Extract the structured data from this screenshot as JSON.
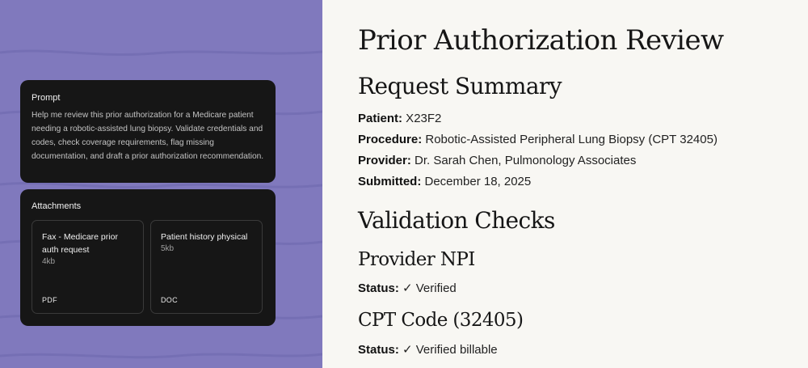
{
  "prompt": {
    "title": "Prompt",
    "text": "Help me review this prior authorization for a Medicare patient needing a robotic-assisted lung biopsy. Validate credentials and codes, check coverage requirements, flag missing documentation, and draft a prior authorization recommendation."
  },
  "attachments": {
    "title": "Attachments",
    "files": [
      {
        "name": "Fax - Medicare prior auth request",
        "size": "4kb",
        "type": "PDF"
      },
      {
        "name": "Patient history physical",
        "size": "5kb",
        "type": "DOC"
      }
    ]
  },
  "document": {
    "title": "Prior Authorization Review",
    "summary": {
      "heading": "Request Summary",
      "patient_label": "Patient:",
      "patient_value": " X23F2",
      "procedure_label": "Procedure:",
      "procedure_value": " Robotic-Assisted Peripheral Lung Biopsy (CPT 32405)",
      "provider_label": "Provider:",
      "provider_value": " Dr. Sarah Chen, Pulmonology Associates",
      "submitted_label": "Submitted:",
      "submitted_value": " December 18, 2025"
    },
    "validation": {
      "heading": "Validation Checks",
      "checks": [
        {
          "heading": "Provider NPI",
          "status_label": "Status:",
          "status_value": " ✓ Verified"
        },
        {
          "heading": "CPT Code (32405)",
          "status_label": "Status:",
          "status_value": " ✓ Verified billable"
        }
      ]
    }
  },
  "colors": {
    "left_panel": "#8079bd",
    "card_bg": "#161616",
    "doc_bg": "#f8f7f3"
  }
}
